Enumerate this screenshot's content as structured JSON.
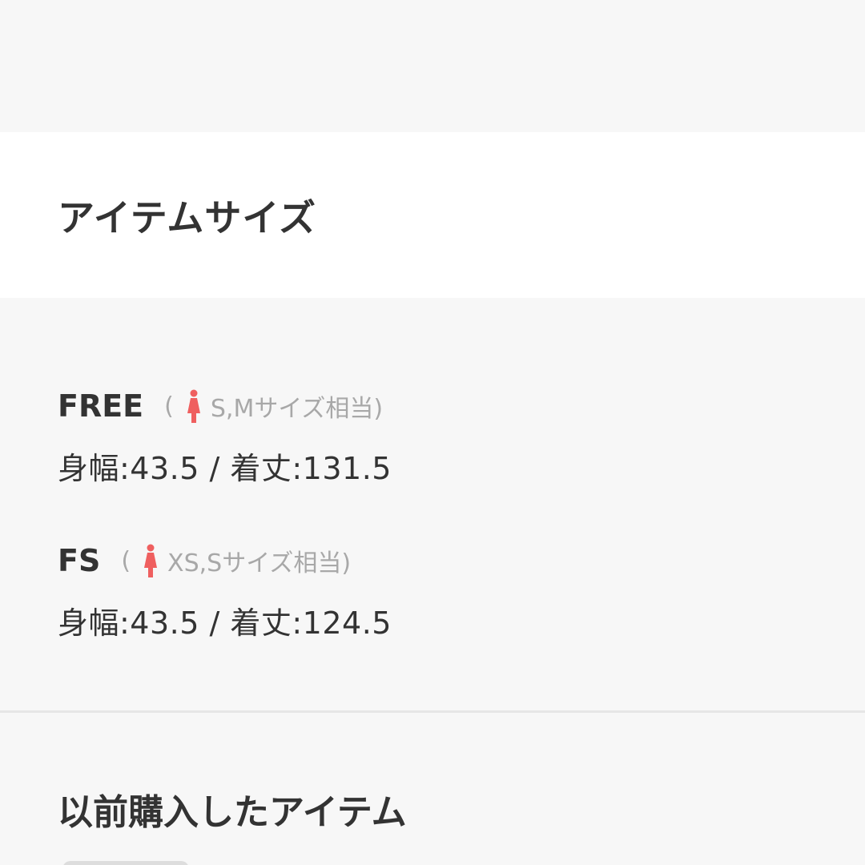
{
  "item_size": {
    "title": "アイテムサイズ",
    "sizes": [
      {
        "name": "FREE",
        "paren_open": "(",
        "equivalent": "S,Mサイズ相当)",
        "measurements": "身幅:43.5 / 着丈:131.5"
      },
      {
        "name": "FS",
        "paren_open": "(",
        "equivalent": "XS,Sサイズ相当)",
        "measurements": "身幅:43.5 / 着丈:124.5"
      }
    ],
    "icon": "female-person-icon",
    "icon_color": "#ef5f5f"
  },
  "previous_purchases": {
    "title": "以前購入したアイテム"
  }
}
